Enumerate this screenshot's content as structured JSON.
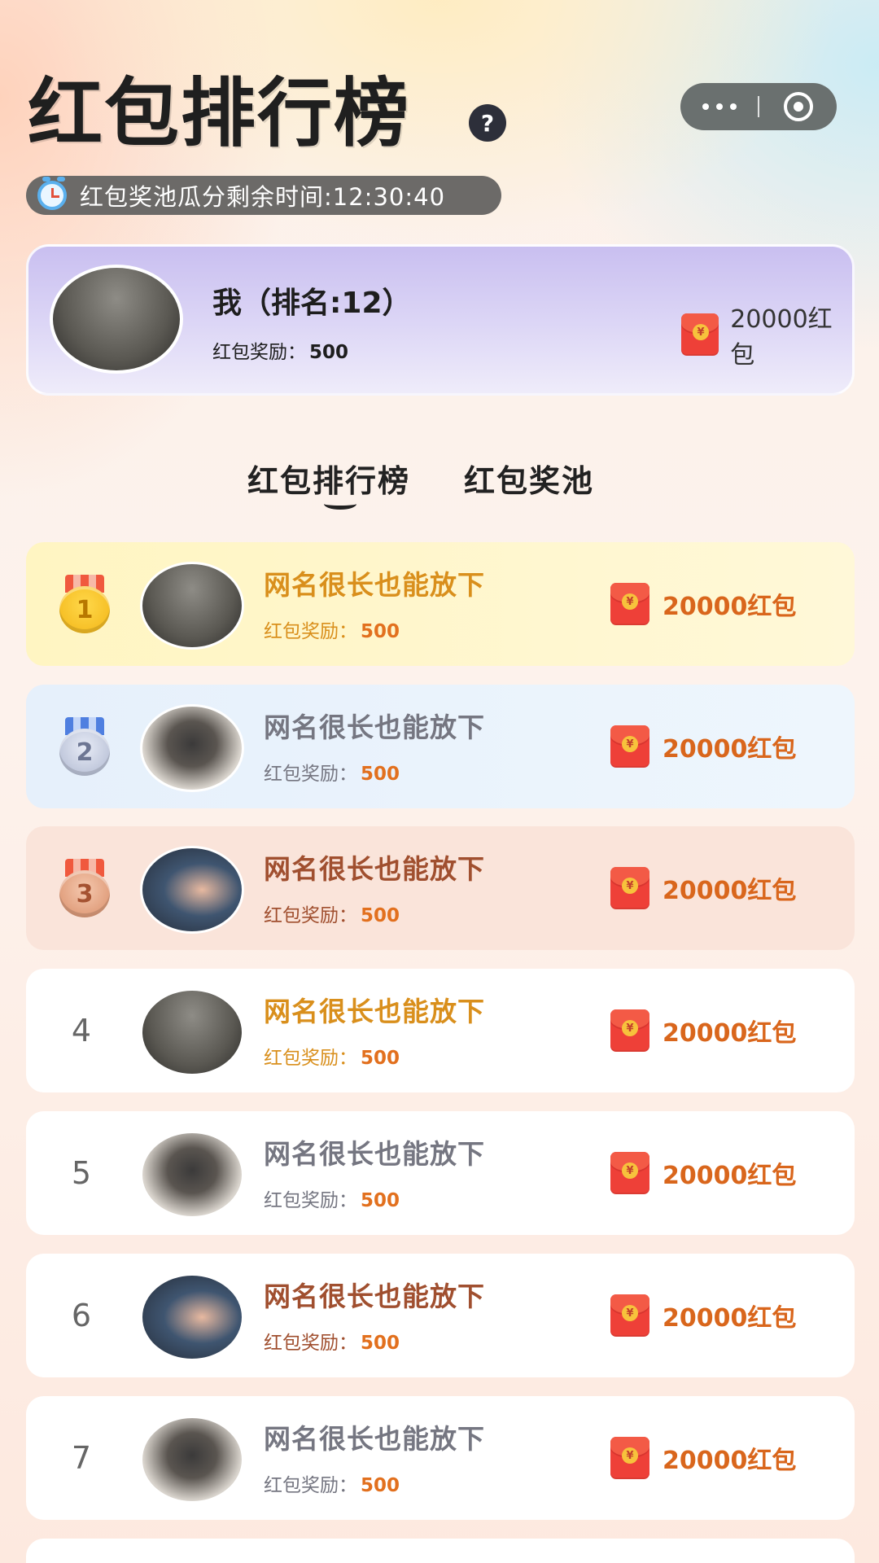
{
  "header": {
    "title": "红包排行榜",
    "help_label": "?",
    "timer_text": "红包奖池瓜分剩余时间:12:30:40"
  },
  "my_card": {
    "name": "我（排名:12）",
    "reward_label": "红包奖励：",
    "reward_value": "500",
    "amount": "20000红包"
  },
  "tabs": [
    {
      "label": "红包排行榜",
      "active": true
    },
    {
      "label": "红包奖池",
      "active": false
    }
  ],
  "rows": [
    {
      "rank": "1",
      "name": "网名很长也能放下",
      "reward_label": "红包奖励：",
      "reward_value": "500",
      "amount": "20000红包"
    },
    {
      "rank": "2",
      "name": "网名很长也能放下",
      "reward_label": "红包奖励：",
      "reward_value": "500",
      "amount": "20000红包"
    },
    {
      "rank": "3",
      "name": "网名很长也能放下",
      "reward_label": "红包奖励：",
      "reward_value": "500",
      "amount": "20000红包"
    },
    {
      "rank": "4",
      "name": "网名很长也能放下",
      "reward_label": "红包奖励：",
      "reward_value": "500",
      "amount": "20000红包"
    },
    {
      "rank": "5",
      "name": "网名很长也能放下",
      "reward_label": "红包奖励：",
      "reward_value": "500",
      "amount": "20000红包"
    },
    {
      "rank": "6",
      "name": "网名很长也能放下",
      "reward_label": "红包奖励：",
      "reward_value": "500",
      "amount": "20000红包"
    },
    {
      "rank": "7",
      "name": "网名很长也能放下",
      "reward_label": "红包奖励：",
      "reward_value": "500",
      "amount": "20000红包"
    }
  ],
  "colors": {
    "gold_name": "#d98f1c",
    "gray_name": "#757681",
    "brown_name": "#a04f2f",
    "amount": "#d9661c",
    "my_card_bg": "#c9bff0"
  },
  "icons": [
    "help-icon",
    "more-icon",
    "close-miniprogram-icon",
    "clock-icon",
    "red-envelope-icon",
    "gold-medal-icon",
    "silver-medal-icon",
    "bronze-medal-icon"
  ]
}
